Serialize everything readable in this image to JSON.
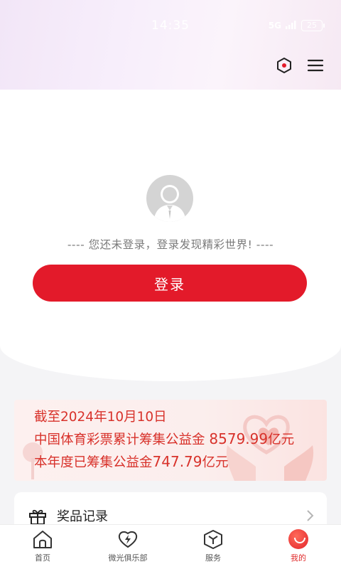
{
  "status_bar": {
    "time": "14:35",
    "signal": "5G",
    "battery": "25"
  },
  "header": {
    "icons": [
      "hexagon-settings-icon",
      "menu-icon"
    ]
  },
  "login": {
    "tip": "---- 您还未登录，登录发现精彩世界! ----",
    "button_label": "登录"
  },
  "charity": {
    "line1": "截至2024年10月10日",
    "line2_prefix": "中国体育彩票累计筹集公益金",
    "line2_amount": "8579.99",
    "line2_unit": "亿元",
    "line3_prefix": "本年度已筹集公益金",
    "line3_amount": "747.79",
    "line3_unit": "亿元",
    "accent_color": "#d8322b"
  },
  "menu": {
    "items": [
      {
        "label": "奖品记录",
        "icon": "gift-icon"
      }
    ]
  },
  "bottom_nav": {
    "items": [
      {
        "label": "首页",
        "icon": "home-icon"
      },
      {
        "label": "微光俱乐部",
        "icon": "lightning-icon"
      },
      {
        "label": "服务",
        "icon": "cube-icon"
      },
      {
        "label": "我的",
        "icon": "smile-icon",
        "active": true
      }
    ],
    "active_color": "#e02a2a"
  },
  "colors": {
    "brand_red": "#e31a2a"
  }
}
